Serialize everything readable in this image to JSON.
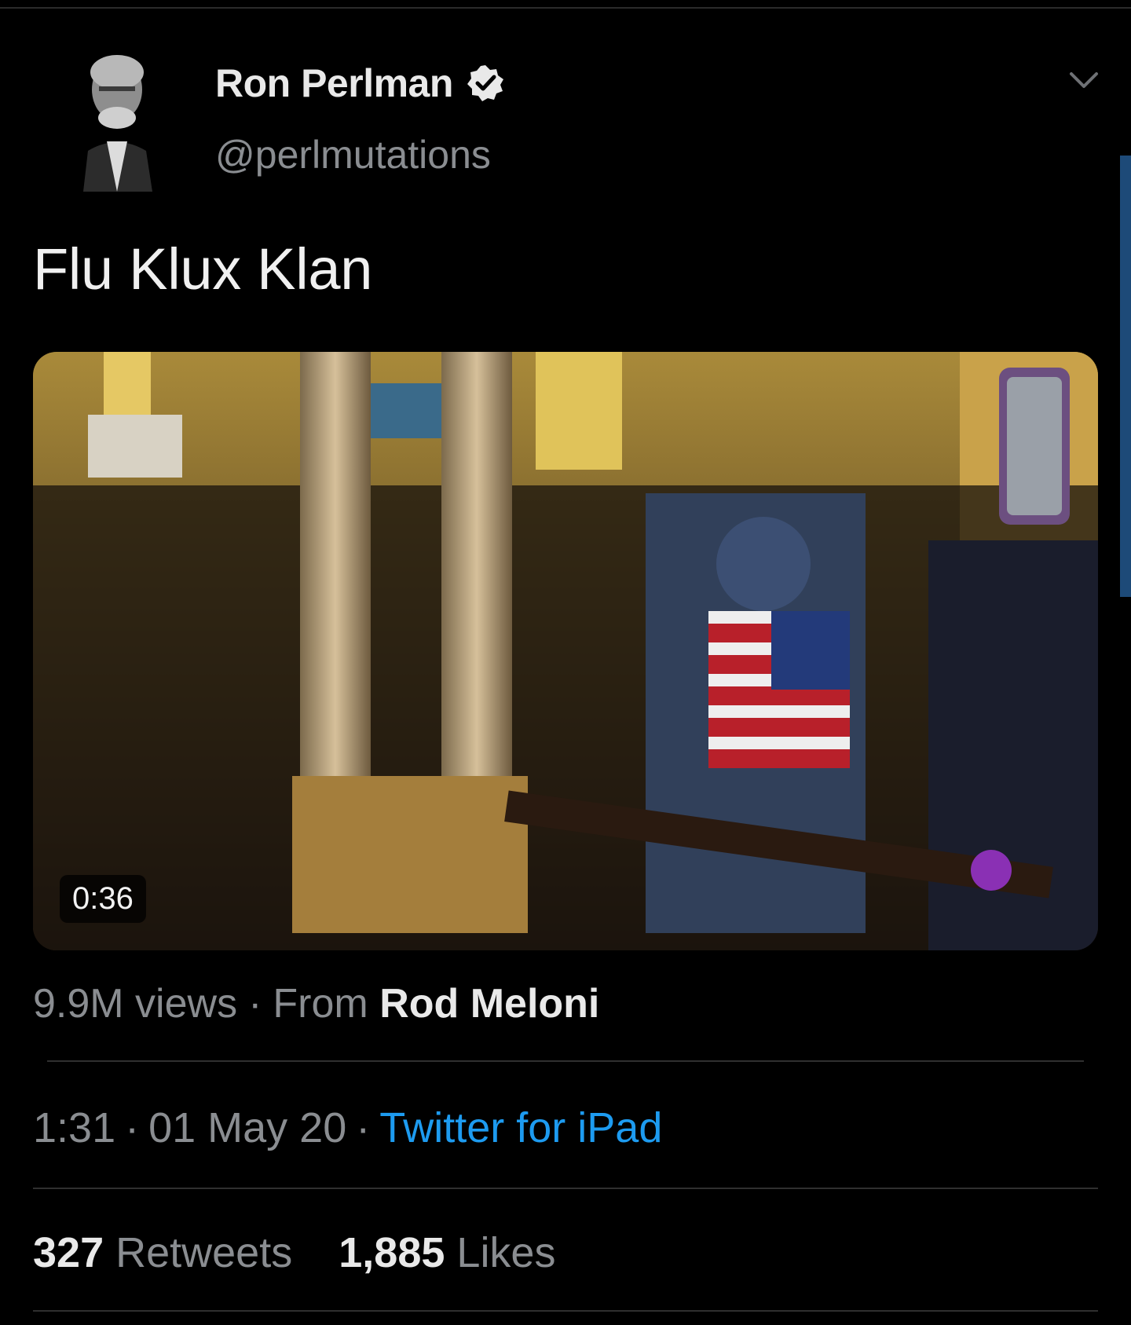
{
  "tweet": {
    "author": {
      "display_name": "Ron Perlman",
      "handle": "@perlmutations",
      "verified": true
    },
    "text": "Flu Klux Klan",
    "media": {
      "type": "video",
      "duration": "0:36"
    },
    "views": "9.9M views",
    "source_prefix": "From",
    "source_name": "Rod Meloni",
    "time": "1:31",
    "date": "01 May 20",
    "client": "Twitter for iPad",
    "separator": "·",
    "retweets_count": "327",
    "retweets_label": "Retweets",
    "likes_count": "1,885",
    "likes_label": "Likes"
  },
  "colors": {
    "background": "#000000",
    "link": "#1d9bf0",
    "secondary_text": "#8a8d91",
    "primary_text": "#e9e9e9"
  }
}
